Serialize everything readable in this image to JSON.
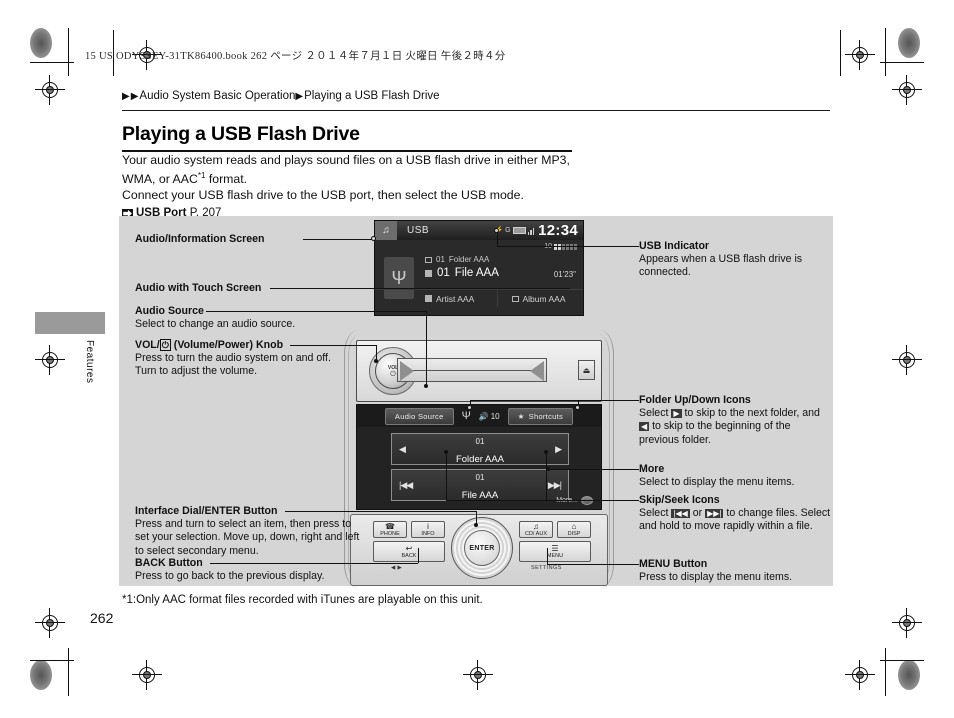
{
  "book_line": "15 US ODYSSEY-31TK86400.book   262 ページ   ２０１４年７月１日   火曜日   午後２時４分",
  "breadcrumb": {
    "arrow": "▶",
    "part1": "Audio System Basic Operation",
    "part2": "Playing a USB Flash Drive"
  },
  "page_title": "Playing a USB Flash Drive",
  "intro": {
    "line1a": "Your audio system reads and plays sound files on a USB flash drive in either MP3, WMA, or AAC",
    "sup": "*1",
    "line1b": " format.",
    "line2": "Connect your USB flash drive to the USB port, then select the USB mode.",
    "ref_icon": "⮕",
    "ref_bold": "USB Port",
    "ref_page": "P. 207"
  },
  "side_tab_label": "Features",
  "callouts_left": [
    {
      "title": "Audio/Information Screen",
      "body": ""
    },
    {
      "title": "Audio with Touch Screen",
      "body": ""
    },
    {
      "title": "Audio Source",
      "body": "Select to change an audio source."
    },
    {
      "title_pre": "VOL/",
      "title_icon": "⏻",
      "title_post": " (Volume/Power) Knob",
      "body": "Press to turn the audio system on and off.\nTurn to adjust the volume."
    },
    {
      "title": "Interface Dial/ENTER Button",
      "body": "Press and turn to select an item, then press to set your selection. Move up, down, right and left to select secondary menu."
    },
    {
      "title": "BACK Button",
      "body": "Press to go back to the previous display."
    }
  ],
  "callouts_right": [
    {
      "title": "USB Indicator",
      "body": "Appears when a USB flash drive is connected."
    },
    {
      "title": "Folder Up/Down Icons",
      "body_a": "Select ",
      "icon_a": "▶",
      "body_b": " to skip to the next folder, and ",
      "icon_b": "◀",
      "body_c": " to skip to the beginning of the previous folder."
    },
    {
      "title": "More",
      "body": "Select to display the menu items."
    },
    {
      "title": "Skip/Seek Icons",
      "body_a": "Select ",
      "icon_a": "|◀◀",
      "body_b": " or ",
      "icon_b": "▶▶|",
      "body_c": " to change files. Select and hold to move rapidly within a file."
    },
    {
      "title": "MENU Button",
      "body": "Press to display the menu items."
    }
  ],
  "device_screen": {
    "tab_icon": "♫",
    "source_label": "USB",
    "usb_status_icon": "⚡",
    "clock": "12:34",
    "volume_label": "10",
    "usb_glyph": "Ψ",
    "folder_index": "01",
    "folder_name": "Folder AAA",
    "file_index": "01",
    "file_name": "File AAA",
    "file_time": "01'23\"",
    "artist": "Artist AAA",
    "album": "Album AAA"
  },
  "touch_screen": {
    "audio_source_btn": "Audio Source",
    "usb_icon": "Ψ",
    "volume_icon": "🔊",
    "volume_value": "10",
    "shortcuts_star": "★",
    "shortcuts_btn": "Shortcuts",
    "folder_prev_icon": "◀",
    "folder_index": "01",
    "folder_label": "Folder AAA",
    "folder_next_icon": "▶",
    "file_prev_icon": "|◀◀",
    "file_index": "01",
    "file_label": "File AAA",
    "file_next_icon": "▶▶|",
    "more_label": "More..."
  },
  "hard_buttons": {
    "knob_line1": "VOL",
    "knob_line2": "⏻",
    "eject_icon": "⏏",
    "phone_glyph": "☎",
    "phone_label": "PHONE",
    "info_glyph": "i",
    "info_label": "INFO",
    "clock_glyph": "♫",
    "clock_label": "CD/\nAUX",
    "home_glyph": "⌂",
    "home_label": "DISP",
    "back_glyph": "↩",
    "back_label": "BACK",
    "menu_glyph": "☰",
    "menu_label": "MENU",
    "enter_label": "ENTER",
    "settings_label": "SETTINGS",
    "back_sub": "◀ ▶"
  },
  "footnote": "*1:Only AAC format files recorded with iTunes are playable on this unit.",
  "page_number": "262"
}
